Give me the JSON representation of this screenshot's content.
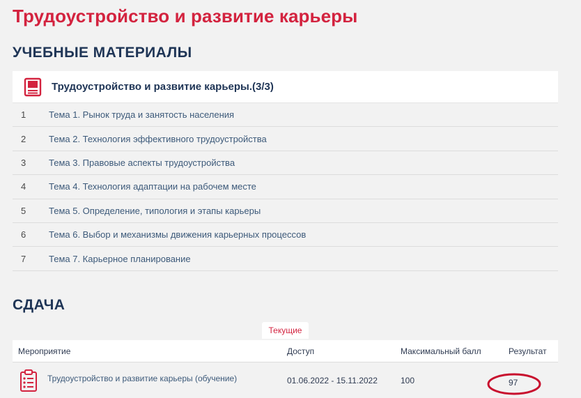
{
  "page": {
    "title": "Трудоустройство и развитие карьеры"
  },
  "materials": {
    "section_title": "УЧЕБНЫЕ МАТЕРИАЛЫ",
    "course_title": "Трудоустройство и развитие карьеры.(3/3)",
    "course_icon": "book-icon",
    "topics": [
      {
        "num": "1",
        "label": "Тема 1. Рынок труда и занятость населения"
      },
      {
        "num": "2",
        "label": "Тема 2. Технология эффективного трудоустройства"
      },
      {
        "num": "3",
        "label": "Тема 3. Правовые аспекты трудоустройства"
      },
      {
        "num": "4",
        "label": "Тема 4. Технология адаптации на рабочем месте"
      },
      {
        "num": "5",
        "label": "Тема 5. Определение, типология и этапы карьеры"
      },
      {
        "num": "6",
        "label": "Тема 6. Выбор и механизмы движения карьерных процессов"
      },
      {
        "num": "7",
        "label": "Тема 7. Карьерное планирование"
      }
    ]
  },
  "exam": {
    "section_title": "СДАЧА",
    "tab_label": "Текущие",
    "columns": {
      "event": "Мероприятие",
      "access": "Доступ",
      "max_score": "Максимальный балл",
      "result": "Результат"
    },
    "rows": [
      {
        "icon": "clipboard-icon",
        "event": "Трудоустройство и развитие карьеры (обучение)",
        "access": "01.06.2022 - 15.11.2022",
        "max_score": "100",
        "result": "97"
      }
    ]
  },
  "colors": {
    "accent": "#d3233f",
    "heading": "#1f3556",
    "link": "#3d5a7a",
    "background": "#f2f2f2"
  }
}
